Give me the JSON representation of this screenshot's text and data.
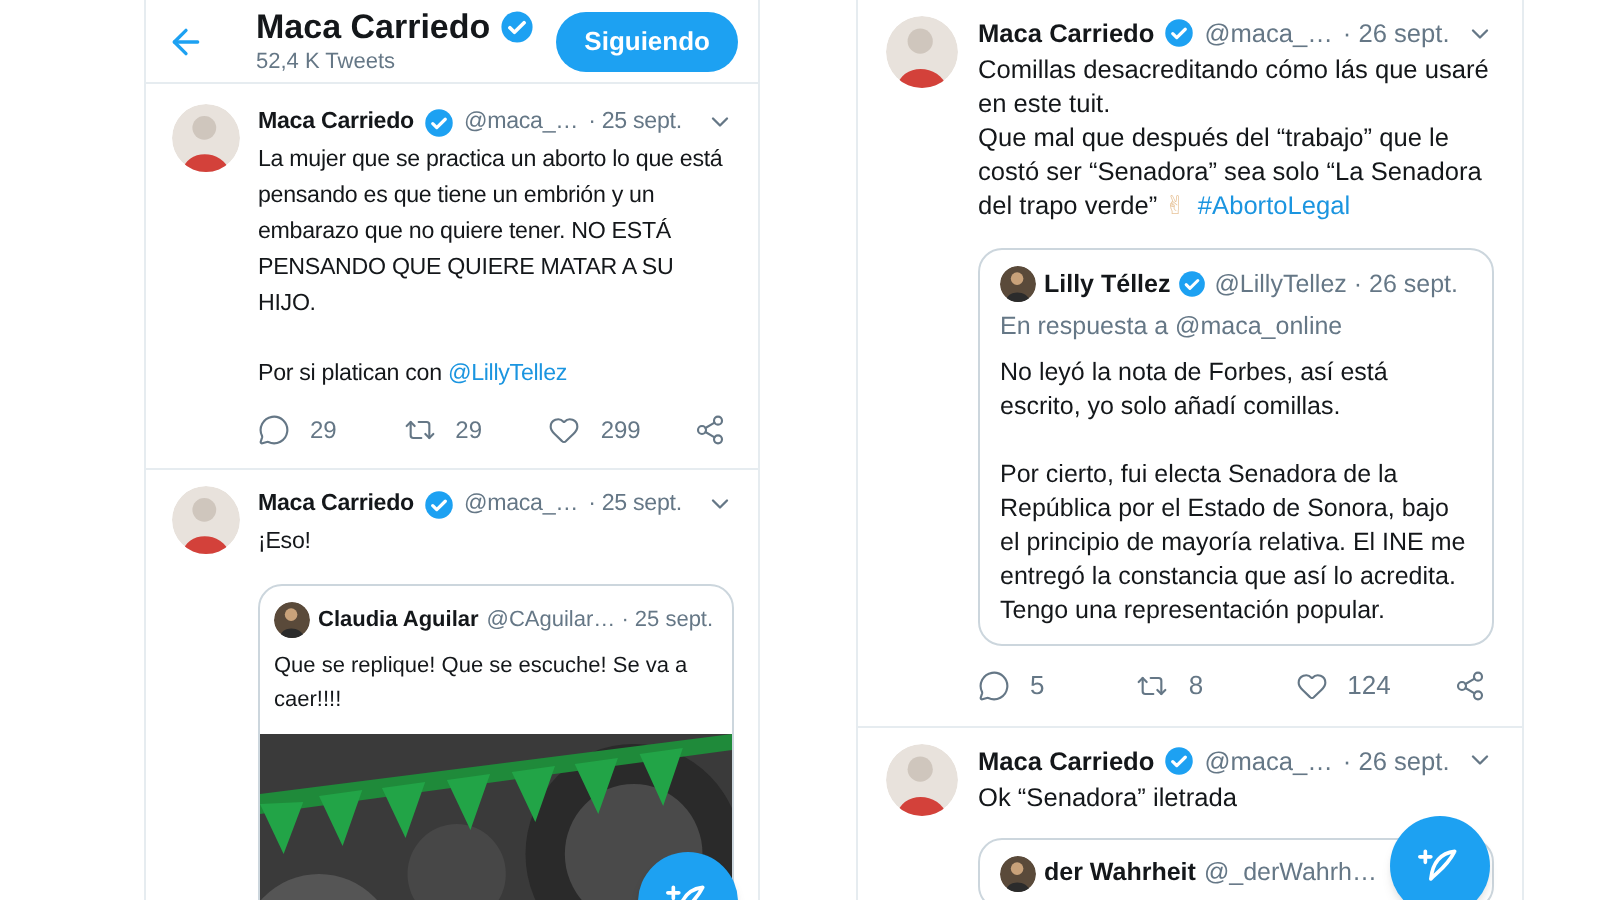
{
  "columns": [
    {
      "header": {
        "title": "Maca Carriedo",
        "verified": true,
        "subtitle": "52,4 K Tweets",
        "follow_button": "Siguiendo"
      },
      "tweets": [
        {
          "name": "Maca Carriedo",
          "verified": true,
          "handle": "@maca_…",
          "date": "· 25 sept.",
          "paragraphs": [
            [
              {
                "kind": "text",
                "text": "La mujer que se practica un aborto lo que está pensando es que tiene un embrión y un embarazo que no quiere tener. NO ESTÁ PENSANDO QUE QUIERE MATAR A SU HIJO."
              }
            ],
            [
              {
                "kind": "text",
                "text": "Por si platican con "
              },
              {
                "kind": "link",
                "text": "@LillyTellez"
              }
            ]
          ],
          "actions": {
            "replies": "29",
            "retweets": "29",
            "likes": "299"
          }
        },
        {
          "name": "Maca Carriedo",
          "verified": true,
          "handle": "@maca_…",
          "date": "· 25 sept.",
          "paragraphs": [
            [
              {
                "kind": "text",
                "text": "¡Eso!"
              }
            ]
          ],
          "quote": {
            "name": "Claudia Aguilar",
            "verified": false,
            "handle": "@CAguilar… · 25 sept.",
            "paragraphs": [
              [
                {
                  "kind": "text",
                  "text": "Que se replique! Que se escuche! Se va a caer!!!!"
                }
              ]
            ],
            "media": {
              "kind": "picture"
            }
          }
        }
      ]
    },
    {
      "tweets": [
        {
          "name": "Maca Carriedo",
          "verified": true,
          "handle": "@maca_…",
          "date": "· 26 sept.",
          "paragraphs": [
            [
              {
                "kind": "text",
                "text": "Comillas desacreditando cómo lás que usaré en este tuit.\nQue mal que después del “trabajo” que le costó ser “Senadora” sea solo “La Senadora del trapo verde” "
              },
              {
                "kind": "emoji",
                "text": "✌"
              },
              {
                "kind": "link",
                "text": "#AbortoLegal"
              }
            ]
          ],
          "quote": {
            "name": "Lilly Téllez",
            "verified": true,
            "handle": "@LillyTellez · 26 sept.",
            "reply_to": "En respuesta a @maca_online",
            "paragraphs": [
              [
                {
                  "kind": "text",
                  "text": "No leyó la nota de Forbes, así está escrito, yo solo añadí comillas."
                }
              ],
              [
                {
                  "kind": "text",
                  "text": "Por cierto, fui electa Senadora de la República por el Estado de Sonora, bajo el principio de mayoría relativa. El INE me entregó la constancia que así lo acredita. Tengo una representación popular."
                }
              ]
            ]
          },
          "actions": {
            "replies": "5",
            "retweets": "8",
            "likes": "124"
          }
        },
        {
          "name": "Maca Carriedo",
          "verified": true,
          "handle": "@maca_…",
          "date": "· 26 sept.",
          "paragraphs": [
            [
              {
                "kind": "text",
                "text": "Ok “Senadora” iletrada"
              }
            ]
          ],
          "quote": {
            "name": "der Wahrheit",
            "verified": false,
            "handle": "@_derWahrh…"
          }
        }
      ]
    }
  ]
}
